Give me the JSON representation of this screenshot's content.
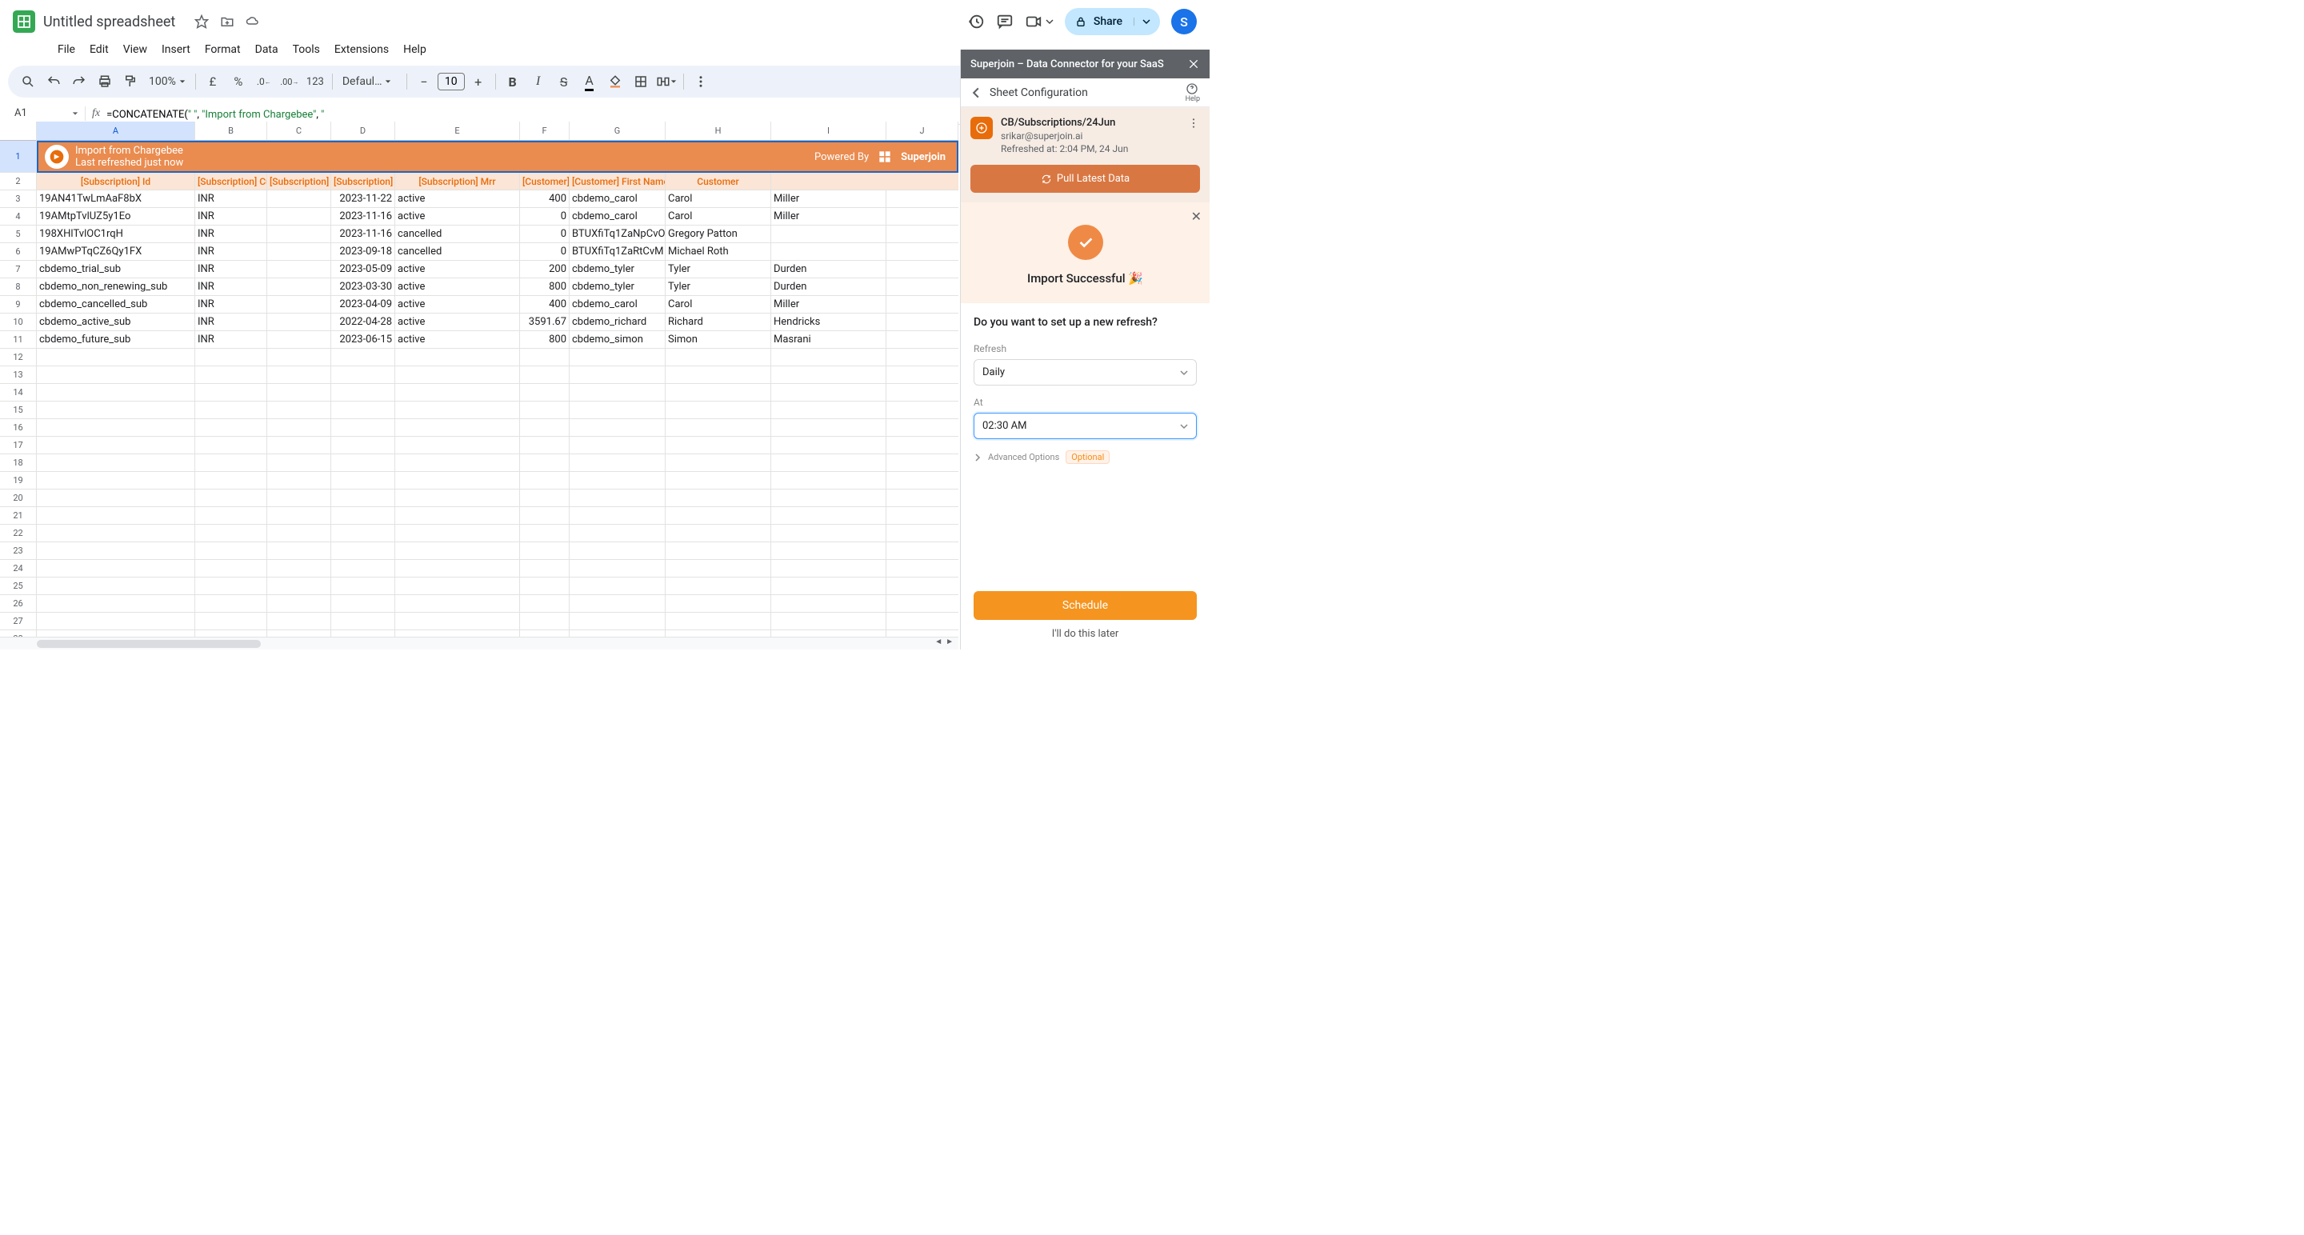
{
  "doc": {
    "title": "Untitled spreadsheet"
  },
  "menus": [
    "File",
    "Edit",
    "View",
    "Insert",
    "Format",
    "Data",
    "Tools",
    "Extensions",
    "Help"
  ],
  "toolbar": {
    "zoom": "100%",
    "currency": "£",
    "percent": "%",
    "dec_dec": ".0",
    "inc_dec": ".00",
    "numfmt": "123",
    "font": "Defaul…",
    "fontsize": "10"
  },
  "share": {
    "label": "Share",
    "avatar": "S"
  },
  "namebox": "A1",
  "formula": {
    "prefix": "=CONCATENATE(",
    "s1": "\"           \"",
    "sep1": ", ",
    "s2": "\"Import from Chargebee\"",
    "sep2": ", ",
    "s3": "\""
  },
  "columns": [
    "A",
    "B",
    "C",
    "D",
    "E",
    "F",
    "G",
    "H",
    "I",
    "J"
  ],
  "banner": {
    "title": "Import from Chargebee",
    "subtitle": "Last refreshed just now",
    "powered": "Powered By",
    "brand": "Superjoin"
  },
  "headers": [
    "[Subscription] Id",
    "[Subscription] Currency Code",
    "[Subscription] Started At",
    "[Subscription] Status",
    "[Subscription] Mrr",
    "[Customer] Id",
    "[Customer] First Name",
    "Customer"
  ],
  "rows": [
    {
      "a": "19AN41TwLmAaF8bX",
      "b": "INR",
      "d": "2023-11-22",
      "e": "active",
      "f": "400",
      "g": "cbdemo_carol",
      "h": "Carol",
      "i": "Miller"
    },
    {
      "a": "19AMtpTvlUZ5y1Eo",
      "b": "INR",
      "d": "2023-11-16",
      "e": "active",
      "f": "0",
      "g": "cbdemo_carol",
      "h": "Carol",
      "i": "Miller"
    },
    {
      "a": "198XHlTvlOC1rqH",
      "b": "INR",
      "d": "2023-11-16",
      "e": "cancelled",
      "f": "0",
      "g": "BTUXfiTq1ZaNpCvO",
      "h": "Gregory Patton",
      "i": ""
    },
    {
      "a": "19AMwPTqCZ6Qy1FX",
      "b": "INR",
      "d": "2023-09-18",
      "e": "cancelled",
      "f": "0",
      "g": "BTUXfiTq1ZaRtCvM",
      "h": "Michael Roth",
      "i": ""
    },
    {
      "a": "cbdemo_trial_sub",
      "b": "INR",
      "d": "2023-05-09",
      "e": "active",
      "f": "200",
      "g": "cbdemo_tyler",
      "h": "Tyler",
      "i": "Durden"
    },
    {
      "a": "cbdemo_non_renewing_sub",
      "b": "INR",
      "d": "2023-03-30",
      "e": "active",
      "f": "800",
      "g": "cbdemo_tyler",
      "h": "Tyler",
      "i": "Durden"
    },
    {
      "a": "cbdemo_cancelled_sub",
      "b": "INR",
      "d": "2023-04-09",
      "e": "active",
      "f": "400",
      "g": "cbdemo_carol",
      "h": "Carol",
      "i": "Miller"
    },
    {
      "a": "cbdemo_active_sub",
      "b": "INR",
      "d": "2022-04-28",
      "e": "active",
      "f": "3591.67",
      "g": "cbdemo_richard",
      "h": "Richard",
      "i": "Hendricks"
    },
    {
      "a": "cbdemo_future_sub",
      "b": "INR",
      "d": "2023-06-15",
      "e": "active",
      "f": "800",
      "g": "cbdemo_simon",
      "h": "Simon",
      "i": "Masrani"
    }
  ],
  "sidebar": {
    "title": "Superjoin – Data Connector for your SaaS",
    "config": "Sheet Configuration",
    "help": "Help",
    "card": {
      "title": "CB/Subscriptions/24Jun",
      "email": "srikar@superjoin.ai",
      "refreshed": "Refreshed at: 2:04 PM, 24 Jun",
      "pull": "Pull Latest Data"
    },
    "success": "Import Successful 🎉",
    "question": "Do you want to set up a new refresh?",
    "refresh_label": "Refresh",
    "refresh_value": "Daily",
    "at_label": "At",
    "at_value": "02:30 AM",
    "advanced": "Advanced Options",
    "optional": "Optional",
    "schedule": "Schedule",
    "later": "I'll do this later"
  }
}
